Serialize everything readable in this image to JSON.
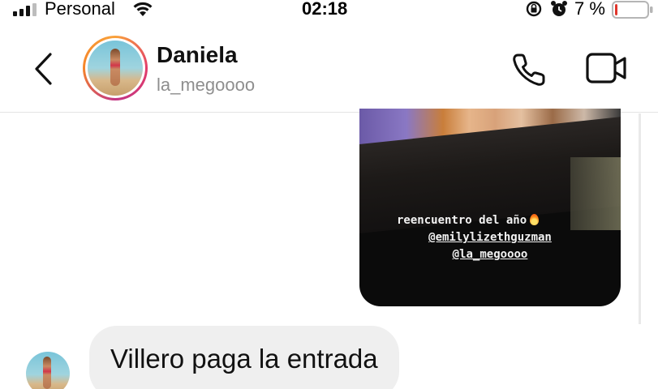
{
  "status_bar": {
    "carrier": "Personal",
    "time": "02:18",
    "battery_percent": "7 %",
    "battery_level": 0.07,
    "battery_color": "#e0352b",
    "icons": [
      "signal-icon",
      "wifi-icon",
      "rotation-lock-icon",
      "alarm-icon",
      "battery-icon"
    ]
  },
  "header": {
    "name": "Daniela",
    "username": "la_megoooo",
    "icons": [
      "back-chevron-icon",
      "phone-icon",
      "video-camera-icon"
    ]
  },
  "messages": [
    {
      "type": "story_reply",
      "story_text": {
        "line1": "reencuentro del año",
        "line2": "@emilylizethguzman",
        "line3": "@la_megoooo"
      },
      "icons": [
        "fire-emoji-icon"
      ]
    },
    {
      "type": "received_text",
      "text": "Villero paga la entrada"
    }
  ],
  "colors": {
    "bubble_received": "#efefef",
    "story_ring": [
      "#f9a13a",
      "#e23c6a",
      "#c13584"
    ],
    "handle_gray": "#8e8e8e"
  }
}
